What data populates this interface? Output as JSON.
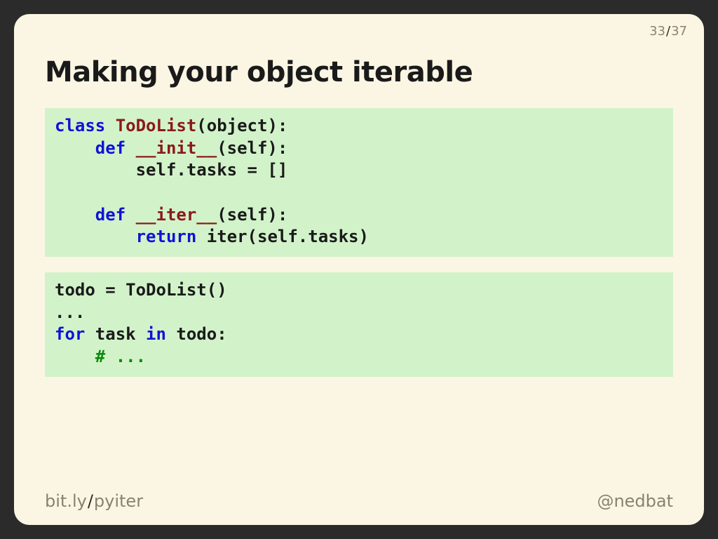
{
  "page": {
    "current": "33",
    "total": "37"
  },
  "title": "Making your object iterable",
  "code1": {
    "tokens": [
      {
        "t": "class ",
        "c": "kw"
      },
      {
        "t": "ToDoList",
        "c": "cls"
      },
      {
        "t": "(object):",
        "c": ""
      },
      {
        "t": "\n",
        "c": ""
      },
      {
        "t": "    ",
        "c": ""
      },
      {
        "t": "def ",
        "c": "kw"
      },
      {
        "t": "__init__",
        "c": "cls"
      },
      {
        "t": "(self):",
        "c": ""
      },
      {
        "t": "\n",
        "c": ""
      },
      {
        "t": "        self.tasks = []",
        "c": ""
      },
      {
        "t": "\n",
        "c": ""
      },
      {
        "t": "\n",
        "c": ""
      },
      {
        "t": "    ",
        "c": ""
      },
      {
        "t": "def ",
        "c": "kw"
      },
      {
        "t": "__iter__",
        "c": "cls"
      },
      {
        "t": "(self):",
        "c": ""
      },
      {
        "t": "\n",
        "c": ""
      },
      {
        "t": "        ",
        "c": ""
      },
      {
        "t": "return ",
        "c": "kw"
      },
      {
        "t": "iter(self.tasks)",
        "c": ""
      }
    ]
  },
  "code2": {
    "tokens": [
      {
        "t": "todo = ToDoList()",
        "c": ""
      },
      {
        "t": "\n",
        "c": ""
      },
      {
        "t": "...",
        "c": ""
      },
      {
        "t": "\n",
        "c": ""
      },
      {
        "t": "for ",
        "c": "kw"
      },
      {
        "t": "task ",
        "c": ""
      },
      {
        "t": "in ",
        "c": "kw"
      },
      {
        "t": "todo:",
        "c": ""
      },
      {
        "t": "\n",
        "c": ""
      },
      {
        "t": "    ",
        "c": ""
      },
      {
        "t": "# ...",
        "c": "com"
      }
    ]
  },
  "footer": {
    "link_host": "bit.ly",
    "link_path": "pyiter",
    "handle": "@nedbat"
  }
}
